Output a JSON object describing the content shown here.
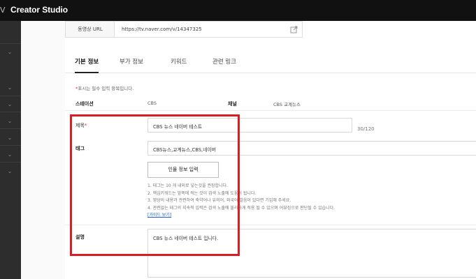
{
  "app": {
    "menu_glyph": "V",
    "title": "Creator Studio"
  },
  "sidebar": {
    "chevrons": 6
  },
  "video_url": {
    "label": "동영상 URL",
    "value": "https://tv.naver.com/v/14347325"
  },
  "tabs": [
    {
      "label": "기본 정보",
      "active": true
    },
    {
      "label": "부가 정보",
      "active": false
    },
    {
      "label": "키워드",
      "active": false
    },
    {
      "label": "관련 링크",
      "active": false
    }
  ],
  "required_note": {
    "marker": "*",
    "text": "표시는 필수 입력 항목입니다."
  },
  "status": {
    "label": "스테이션",
    "value": "CBS"
  },
  "channel": {
    "label": "채널",
    "value": "CBS 교계뉴스"
  },
  "title_field": {
    "label": "제목",
    "required_marker": "*",
    "value": "CBS 뉴스 네이버 테스트",
    "counter": "30/120"
  },
  "tag_field": {
    "label": "태그",
    "value": "CBS뉴스,교계뉴스,CBS,네이버",
    "button": "인물 정보 입력"
  },
  "tag_tips": [
    "1. 태그는 10 개 내외로 넣는것을 권장합니다.",
    "2. 핵심키워드는 앞쪽에 적는 것이 검색 노출에 도움이 됩니다.",
    "3. 영상의 내용과 관련하여 축약어나 유의어, 외국어 발음이 있다면 기입해 주세요.",
    "4. 관련없는 태그의 지속적 입력은 검색 노출에 불리하게 적용 될 수 있으며 어뷰징으로 판단될 수 있습니다."
  ],
  "tag_guide_link": "[가이드 보기]",
  "desc_field": {
    "label": "설명",
    "value": "CBS 뉴스 네이버 테스트 입니다."
  },
  "colors": {
    "highlight": "#d91d22",
    "topbar": "#111111",
    "sidebar": "#2d2d2d",
    "link": "#1a5fd0"
  }
}
